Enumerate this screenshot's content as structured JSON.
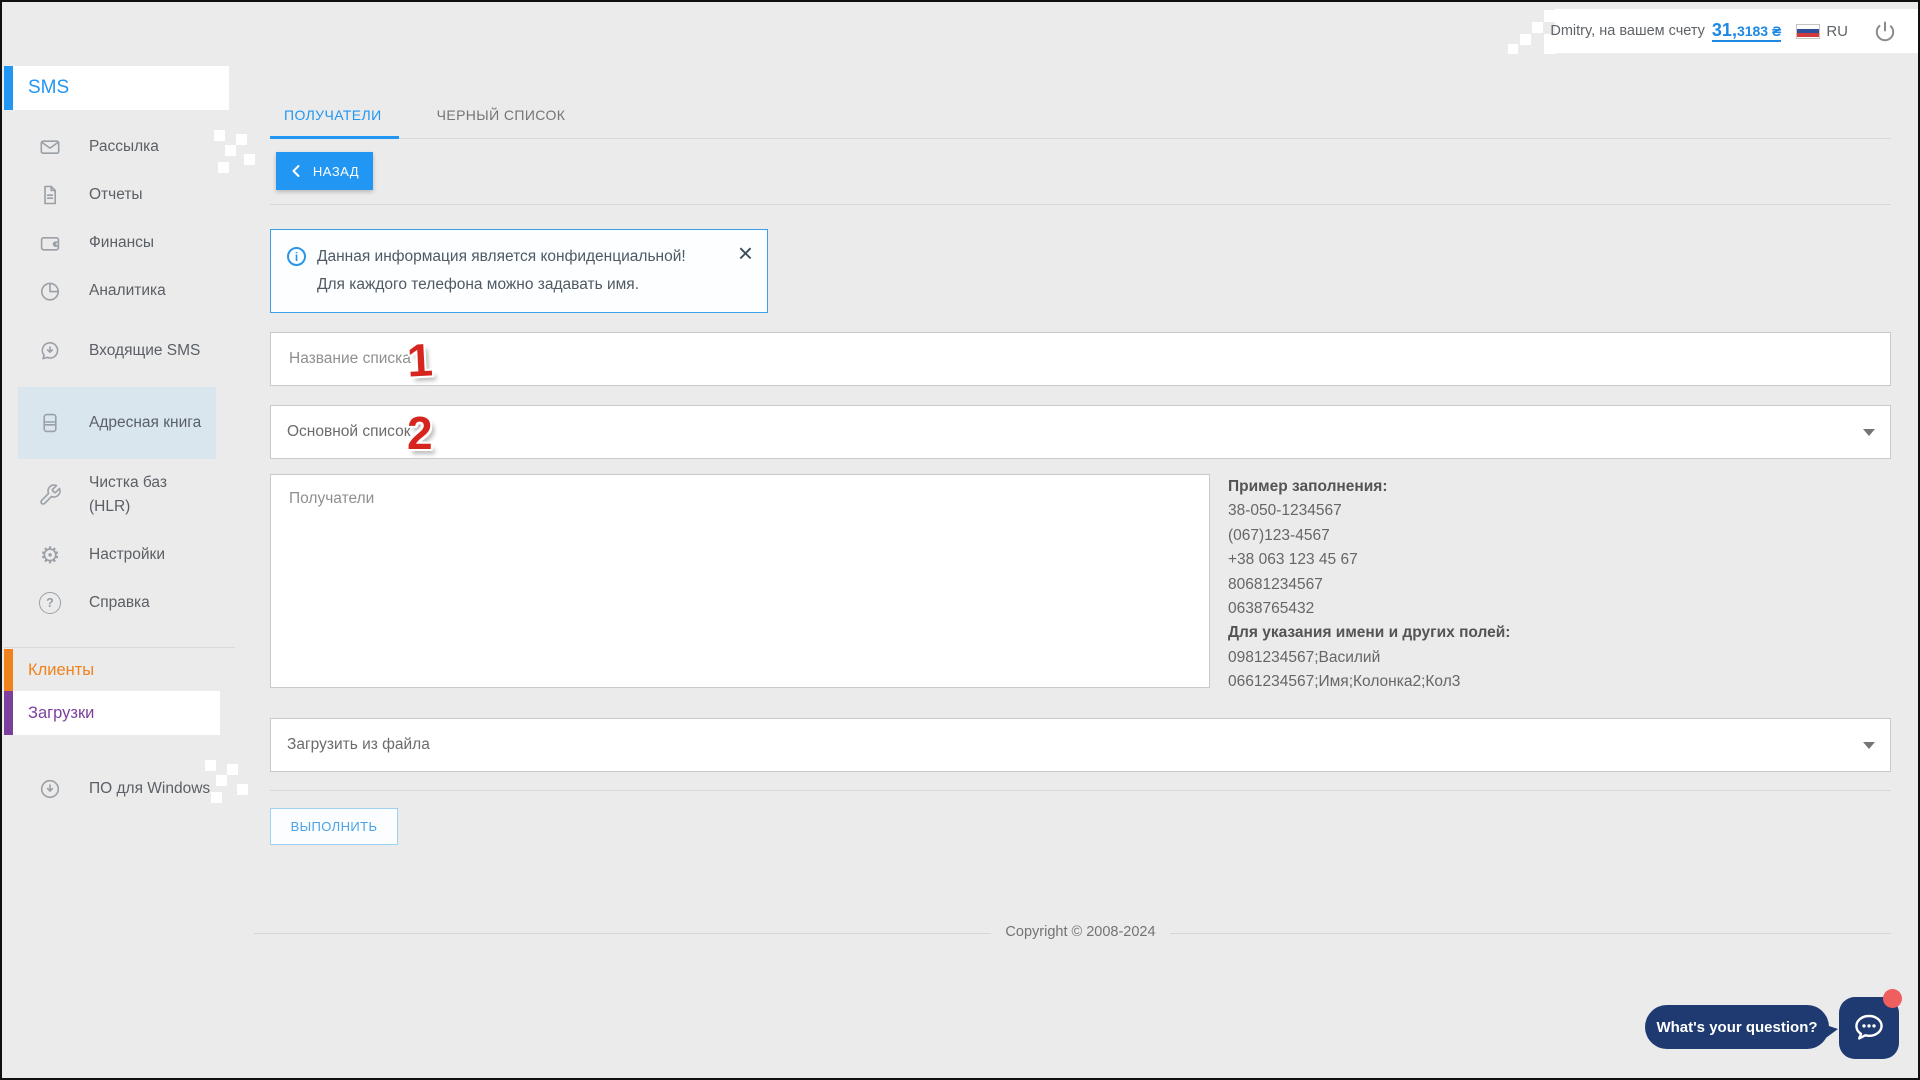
{
  "header": {
    "user_text": "Dmitry, на вашем счету",
    "balance_int": "31,",
    "balance_frac": "3183 ₴",
    "language": "RU"
  },
  "sidebar": {
    "section_sms": "SMS",
    "items": [
      {
        "label": "Рассылка",
        "icon": "mail-icon"
      },
      {
        "label": "Отчеты",
        "icon": "report-icon"
      },
      {
        "label": "Финансы",
        "icon": "wallet-icon"
      },
      {
        "label": "Аналитика",
        "icon": "pie-chart-icon"
      },
      {
        "label": "Входящие SMS",
        "icon": "incoming-sms-icon"
      },
      {
        "label": "Адресная книга",
        "icon": "address-book-icon"
      },
      {
        "label": "Чистка баз (HLR)",
        "icon": "wrench-icon"
      },
      {
        "label": "Настройки",
        "icon": "gear-icon"
      },
      {
        "label": "Справка",
        "icon": "help-icon"
      }
    ],
    "section_clients": "Клиенты",
    "section_downloads": "Загрузки",
    "software_item": "ПО для Windows"
  },
  "tabs": {
    "recipients": "ПОЛУЧАТЕЛИ",
    "blacklist": "ЧЕРНЫЙ СПИСОК"
  },
  "actions": {
    "back": "НАЗАД",
    "execute": "ВЫПОЛНИТЬ"
  },
  "notice": {
    "line1": "Данная информация является конфиденциальной!",
    "line2": "Для каждого телефона можно задавать имя."
  },
  "form": {
    "list_name_placeholder": "Название списка",
    "list_type_value": "Основной список",
    "recipients_placeholder": "Получатели",
    "upload_value": "Загрузить из файла",
    "annotation_1": "1",
    "annotation_2": "2"
  },
  "examples": {
    "heading_fill": "Пример заполнения:",
    "phones": [
      "38-050-1234567",
      "(067)123-4567",
      "+38 063 123 45 67",
      "80681234567",
      "0638765432"
    ],
    "heading_fields": "Для указания имени и других полей:",
    "field_examples": [
      "0981234567;Василий",
      "0661234567;Имя;Колонка2;Кол3"
    ]
  },
  "footer": {
    "copyright": "Copyright © 2008-2024"
  },
  "chat": {
    "prompt": "What's your question?"
  },
  "colors": {
    "accent": "#2196f3",
    "clients_orange": "#f0821e",
    "downloads_purple": "#7d3f9d",
    "chat_navy": "#1e3a70",
    "badge_red": "#f05f5f",
    "annotation_red": "#d6251f",
    "balance_blue": "#1e88e5",
    "active_item_bg": "#d9e6ee"
  }
}
